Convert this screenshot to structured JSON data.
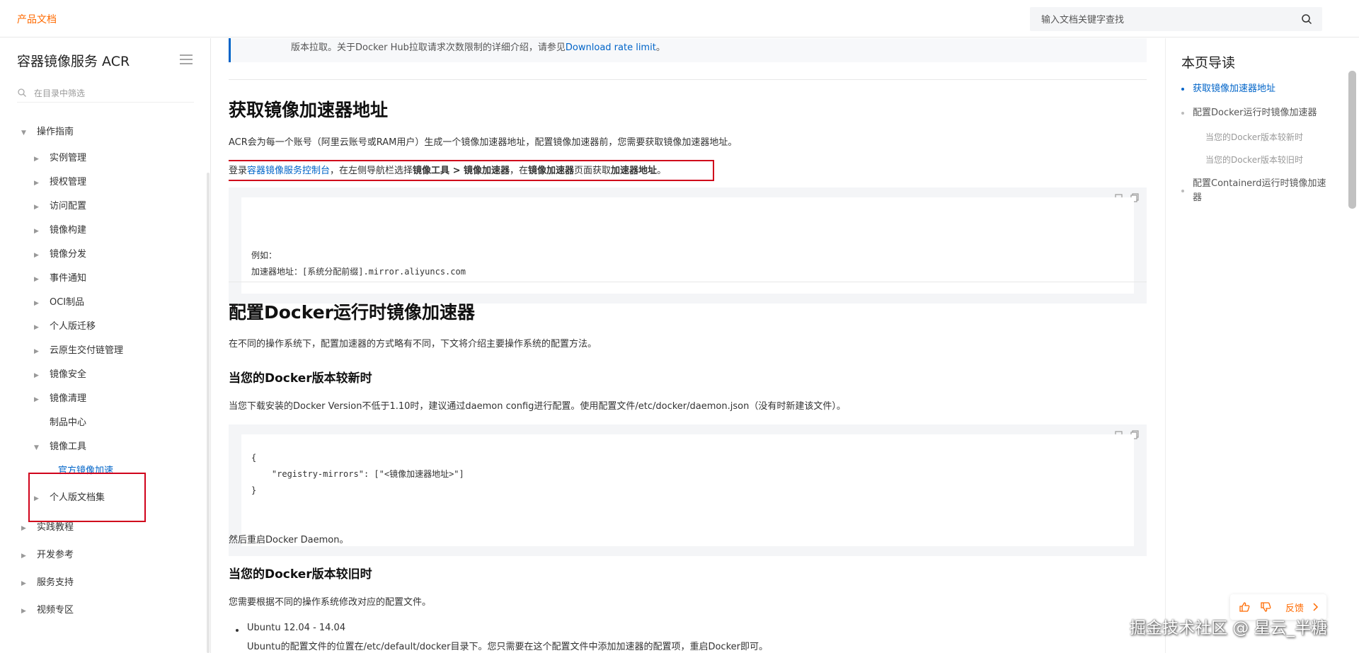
{
  "header": {
    "brand": "产品文档",
    "search_placeholder": "输入文档关键字查找"
  },
  "sidebar": {
    "title": "容器镜像服务 ACR",
    "filter_placeholder": "在目录中筛选",
    "items": [
      {
        "label": "操作指南",
        "arrow": "▼"
      },
      {
        "label": "实例管理",
        "arrow": "▶"
      },
      {
        "label": "授权管理",
        "arrow": "▶"
      },
      {
        "label": "访问配置",
        "arrow": "▶"
      },
      {
        "label": "镜像构建",
        "arrow": "▶"
      },
      {
        "label": "镜像分发",
        "arrow": "▶"
      },
      {
        "label": "事件通知",
        "arrow": "▶"
      },
      {
        "label": "OCI制品",
        "arrow": "▶"
      },
      {
        "label": "个人版迁移",
        "arrow": "▶"
      },
      {
        "label": "云原生交付链管理",
        "arrow": "▶"
      },
      {
        "label": "镜像安全",
        "arrow": "▶"
      },
      {
        "label": "镜像清理",
        "arrow": "▶"
      },
      {
        "label": "制品中心",
        "arrow": ""
      },
      {
        "label": "镜像工具",
        "arrow": "▼"
      },
      {
        "label": "官方镜像加速",
        "arrow": ""
      },
      {
        "label": "个人版文档集",
        "arrow": "▶"
      },
      {
        "label": "实践教程",
        "arrow": "▶"
      },
      {
        "label": "开发参考",
        "arrow": "▶"
      },
      {
        "label": "服务支持",
        "arrow": "▶"
      },
      {
        "label": "视频专区",
        "arrow": "▶"
      }
    ]
  },
  "main": {
    "note_text": "版本拉取。关于Docker Hub拉取请求次数限制的详细介绍，请参见",
    "note_link": "Download rate limit",
    "note_end": "。",
    "section1": {
      "title": "获取镜像加速器地址",
      "intro": "ACR会为每一个账号（阿里云账号或RAM用户）生成一个镜像加速器地址，配置镜像加速器前，您需要获取镜像加速器地址。",
      "step_prefix": "登录",
      "step_link": "容器镜像服务控制台",
      "step_mid1": "，在左侧导航栏选择",
      "step_bold1": "镜像工具 > 镜像加速器",
      "step_mid2": "，在",
      "step_bold2": "镜像加速器",
      "step_mid3": "页面获取",
      "step_bold3": "加速器地址",
      "step_end": "。",
      "code_line1": "例如：",
      "code_line2": "加速器地址：[系统分配前缀].mirror.aliyuncs.com"
    },
    "section2": {
      "title": "配置Docker运行时镜像加速器",
      "intro": "在不同的操作系统下，配置加速器的方式略有不同，下文将介绍主要操作系统的配置方法。",
      "sub1_title": "当您的Docker版本较新时",
      "sub1_text": "当您下载安装的Docker Version不低于1.10时，建议通过daemon config进行配置。使用配置文件/etc/docker/daemon.json（没有时新建该文件）。",
      "code_line1": "{",
      "code_line2": "    \"registry-mirrors\": [\"<镜像加速器地址>\"]",
      "code_line3": "}",
      "restart": "然后重启Docker Daemon。",
      "sub2_title": "当您的Docker版本较旧时",
      "sub2_text": "您需要根据不同的操作系统修改对应的配置文件。",
      "bullet1": "Ubuntu 12.04 - 14.04",
      "bullet1_desc": "Ubuntu的配置文件的位置在/etc/default/docker目录下。您只需要在这个配置文件中添加加速器的配置项，重启Docker即可。"
    }
  },
  "toc": {
    "title": "本页导读",
    "items": [
      "获取镜像加速器地址",
      "配置Docker运行时镜像加速器",
      "当您的Docker版本较新时",
      "当您的Docker版本较旧时",
      "配置Containerd运行时镜像加速器"
    ]
  },
  "feedback": {
    "label": "反馈"
  },
  "watermark": "掘金技术社区 @ 星云_半糖"
}
